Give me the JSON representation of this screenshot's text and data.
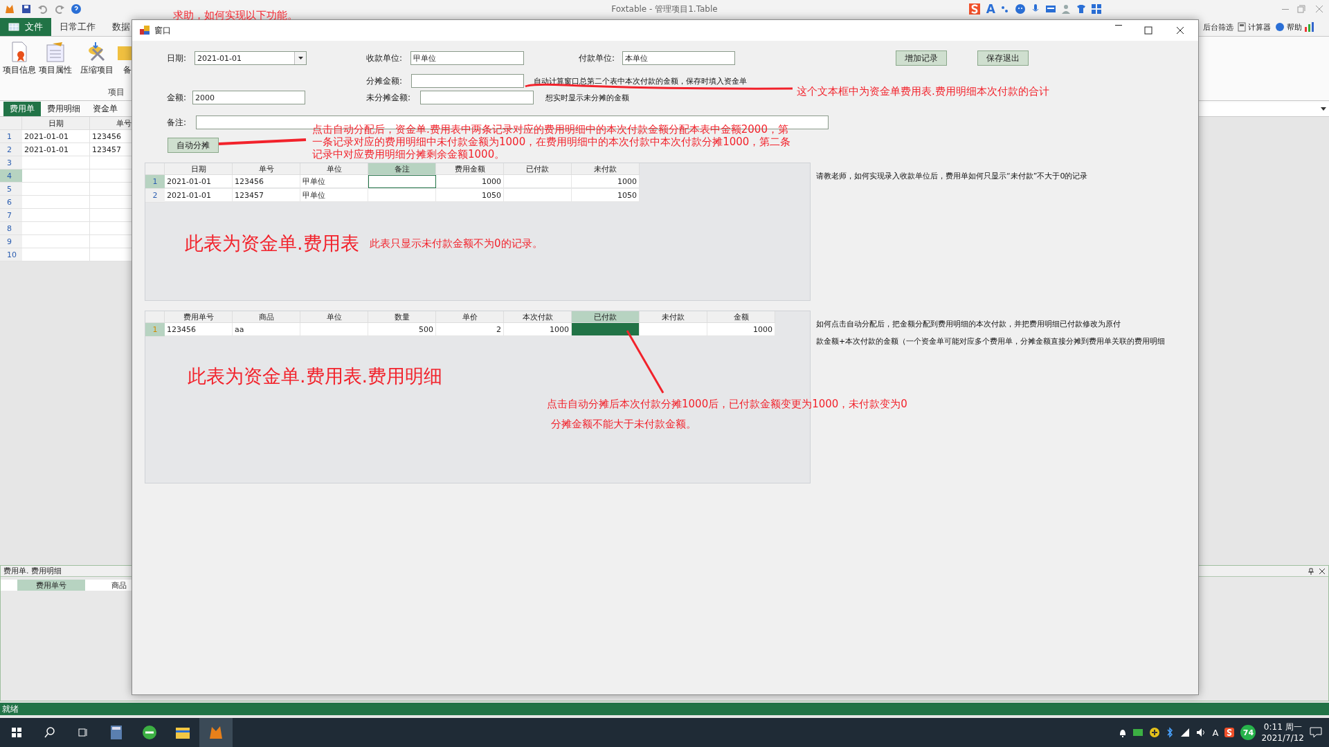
{
  "app": {
    "title": "Foxtable - 管理项目1.Table",
    "help_note": "求助，如何实现以下功能。",
    "ime_letter": "A"
  },
  "menu_tabs": [
    {
      "label": "文件",
      "selected": true
    },
    {
      "label": "日常工作",
      "selected": false
    },
    {
      "label": "数据",
      "selected": false
    }
  ],
  "right_tools": [
    "后台筛选",
    "计算器",
    "帮助"
  ],
  "ribbon": {
    "buttons": [
      "项目信息",
      "项目属性",
      "压缩项目",
      "备"
    ],
    "group": "项目"
  },
  "sheet_tabs": [
    {
      "label": "费用单",
      "selected": true
    },
    {
      "label": "费用明细",
      "selected": false
    },
    {
      "label": "资金单",
      "selected": false
    }
  ],
  "main_grid": {
    "columns": [
      "日期",
      "单号"
    ],
    "rows": [
      {
        "num": "1",
        "cells": [
          "2021-01-01",
          "123456"
        ],
        "selected": false
      },
      {
        "num": "2",
        "cells": [
          "2021-01-01",
          "123457"
        ],
        "selected": false
      },
      {
        "num": "3",
        "cells": [
          null,
          null
        ],
        "selected": false
      },
      {
        "num": "4",
        "cells": [
          null,
          null
        ],
        "selected": true
      },
      {
        "num": "5",
        "cells": [
          null,
          null
        ],
        "selected": false
      },
      {
        "num": "6",
        "cells": [
          null,
          null
        ],
        "selected": false
      },
      {
        "num": "7",
        "cells": [
          null,
          null
        ],
        "selected": false
      },
      {
        "num": "8",
        "cells": [
          null,
          null
        ],
        "selected": false
      },
      {
        "num": "9",
        "cells": [
          null,
          null
        ],
        "selected": false
      },
      {
        "num": "10",
        "cells": [
          null,
          null
        ],
        "selected": false
      }
    ]
  },
  "detail_panel": {
    "title": "费用单. 费用明细",
    "columns": [
      {
        "label": "费用单号",
        "selected": true
      },
      {
        "label": "商品",
        "selected": false
      }
    ]
  },
  "status_bar": "就绪",
  "taskbar": {
    "ime_letter": "A",
    "badge": "74",
    "time": "0:11 周一",
    "date": "2021/7/12"
  },
  "dialog": {
    "title": "窗口",
    "date": {
      "label": "日期:",
      "value": "2021-01-01"
    },
    "payee": {
      "label": "收款单位:",
      "value": "甲单位"
    },
    "payer": {
      "label": "付款单位:",
      "value": "本单位"
    },
    "buttons": [
      "增加记录",
      "保存退出"
    ],
    "allocated": {
      "label": "分摊金额:",
      "note": "自动计算窗口总第二个表中本次付款的金额，保存时填入资金单"
    },
    "amount": {
      "label": "金额:",
      "value": "2000"
    },
    "unallocated": {
      "label": "未分摊金额:",
      "note": "想实时显示未分摊的金额"
    },
    "remark": {
      "label": "备注:"
    },
    "auto_button": "自动分摊",
    "expense_table": {
      "columns": [
        {
          "label": "日期",
          "selected": false
        },
        {
          "label": "单号",
          "selected": false
        },
        {
          "label": "单位",
          "selected": false
        },
        {
          "label": "备注",
          "selected": true
        },
        {
          "label": "费用金额",
          "selected": false
        },
        {
          "label": "已付款",
          "selected": false
        },
        {
          "label": "未付款",
          "selected": false
        }
      ],
      "rows": [
        {
          "num": "1",
          "cells": [
            "2021-01-01",
            "123456",
            "甲单位",
            null,
            "1000",
            null,
            "1000"
          ],
          "selected": true
        },
        {
          "num": "2",
          "cells": [
            "2021-01-01",
            "123457",
            "甲单位",
            null,
            "1050",
            null,
            "1050"
          ],
          "selected": false
        }
      ]
    },
    "expense_notes": [
      "请教老师，如何实现录入收款单位后，费用单如何只显示“未付款”不大于0的记录"
    ],
    "detail_table": {
      "columns": [
        {
          "label": "费用单号",
          "selected": false
        },
        {
          "label": "商品",
          "selected": false
        },
        {
          "label": "单位",
          "selected": false
        },
        {
          "label": "数量",
          "selected": false
        },
        {
          "label": "单价",
          "selected": false
        },
        {
          "label": "本次付款",
          "selected": false
        },
        {
          "label": "已付款",
          "selected": true
        },
        {
          "label": "未付款",
          "selected": false
        },
        {
          "label": "金额",
          "selected": false
        }
      ],
      "rows": [
        {
          "num": "1",
          "cells": [
            "123456",
            "aa",
            null,
            "500",
            "2",
            "1000",
            null,
            null,
            "1000"
          ],
          "selected": true
        }
      ]
    },
    "detail_notes": [
      "如何点击自动分配后，把金额分配到费用明细的本次付款，并把费用明细已付款修改为原付",
      "款金额+本次付款的金额（一个资金单可能对应多个费用单，分摊金额直接分摊到费用单关联的费用明细"
    ]
  },
  "annotations": [
    {
      "kind": "note",
      "text": "这个文本框中为资金单费用表.费用明细本次付款的合计"
    },
    {
      "kind": "note",
      "text": "点击自动分配后，资金单.费用表中两条记录对应的费用明细中的本次付款金额分配本表中金额2000，第一条记录对应的费用明细中未付款金额为1000，在费用明细中的本次付款中本次付款分摊1000，第二条记录中对应费用明细分摊剩余金额1000。"
    },
    {
      "kind": "heading",
      "text": "此表为资金单.费用表"
    },
    {
      "kind": "note",
      "text": "此表只显示未付款金额不为0的记录。"
    },
    {
      "kind": "heading",
      "text": "此表为资金单.费用表.费用明细"
    },
    {
      "kind": "note",
      "text": "点击自动分摊后本次付款分摊1000后，已付款金额变更为1000，未付款变为0"
    },
    {
      "kind": "note",
      "text": "分摊金额不能大于未付款金额。"
    }
  ]
}
